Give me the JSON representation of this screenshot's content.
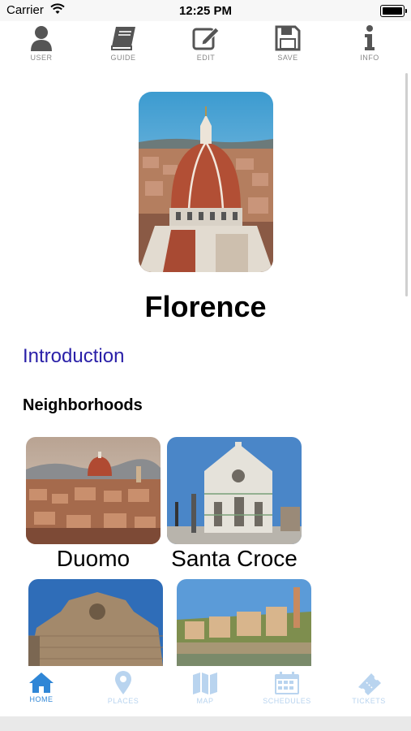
{
  "status_bar": {
    "carrier": "Carrier",
    "time": "12:25 PM"
  },
  "toolbar": {
    "items": [
      {
        "label": "USER",
        "icon": "user-icon"
      },
      {
        "label": "GUIDE",
        "icon": "book-icon"
      },
      {
        "label": "EDIT",
        "icon": "edit-icon"
      },
      {
        "label": "SAVE",
        "icon": "save-icon"
      },
      {
        "label": "INFO",
        "icon": "info-icon"
      }
    ]
  },
  "hero": {
    "icon": "florence-cathedral-photo"
  },
  "city": {
    "name": "Florence"
  },
  "introduction_link": "Introduction",
  "section": {
    "neighborhoods": "Neighborhoods"
  },
  "neighborhoods": [
    {
      "name": "Duomo",
      "icon": "duomo-photo"
    },
    {
      "name": "Santa Croce",
      "icon": "santa-croce-photo"
    },
    {
      "name": "",
      "icon": "san-lorenzo-photo"
    },
    {
      "name": "",
      "icon": "oltrarno-photo"
    }
  ],
  "tabbar": {
    "items": [
      {
        "label": "HOME",
        "icon": "home-icon"
      },
      {
        "label": "PLACES",
        "icon": "map-pin-icon"
      },
      {
        "label": "MAP",
        "icon": "map-icon"
      },
      {
        "label": "SCHEDULES",
        "icon": "calendar-icon"
      },
      {
        "label": "TICKETS",
        "icon": "ticket-icon"
      }
    ]
  },
  "colors": {
    "link": "#2a20a8",
    "tab_active": "#2f86d6",
    "tab_inactive": "#b9d4ef",
    "toolbar_icon": "#555555"
  }
}
